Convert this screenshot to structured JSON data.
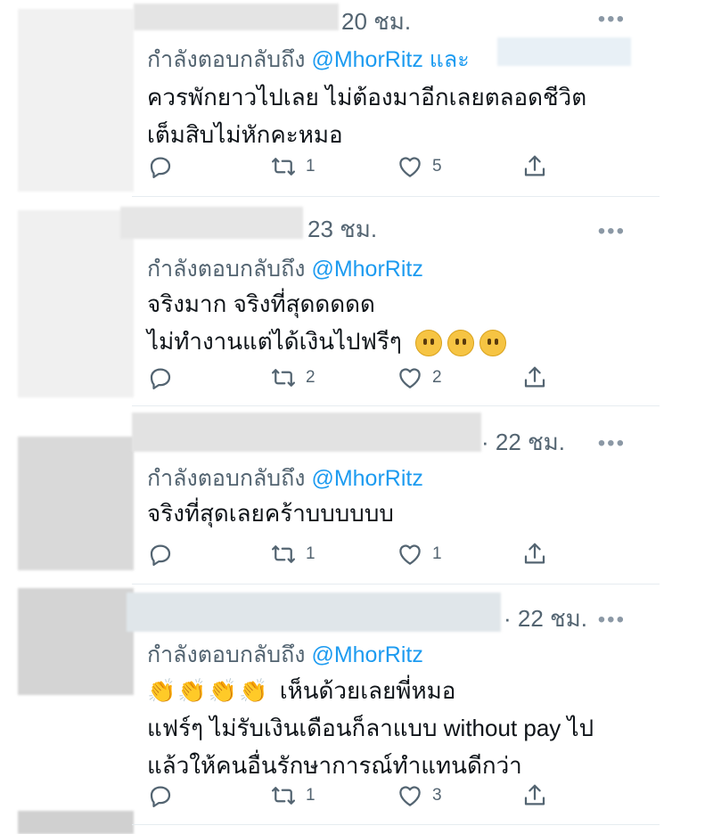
{
  "tweets": [
    {
      "time": "20 ชม.",
      "reply_prefix": "กำลังตอบกลับถึง",
      "reply_handle": "@MhorRitz",
      "reply_suffix": "และ",
      "lines": [
        "ควรพักยาวไปเลย ไม่ต้องมาอีกเลยตลอดชีวิต",
        "เต็มสิบไม่หักคะหมอ"
      ],
      "retweets": "1",
      "likes": "5"
    },
    {
      "time": "23 ชม.",
      "reply_prefix": "กำลังตอบกลับถึง",
      "reply_handle": "@MhorRitz",
      "lines": [
        "จริงมาก จริงที่สุดดดดด",
        "ไม่ทำงานแต่ได้เงินไปฟรีๆ"
      ],
      "retweets": "2",
      "likes": "2"
    },
    {
      "time": "· 22 ชม.",
      "reply_prefix": "กำลังตอบกลับถึง",
      "reply_handle": "@MhorRitz",
      "lines": [
        "จริงที่สุดเลยคร้าบบบบบบ"
      ],
      "retweets": "1",
      "likes": "1"
    },
    {
      "time": "· 22 ชม.",
      "reply_prefix": "กำลังตอบกลับถึง",
      "reply_handle": "@MhorRitz",
      "lines": [
        "เห็นด้วยเลยพี่หมอ",
        "แฟร์ๆ ไม่รับเงินเดือนก็ลาแบบ without pay ไป",
        "แล้วให้คนอื่นรักษาการณ์ทำแทนดีกว่า"
      ],
      "retweets": "1",
      "likes": "3"
    }
  ],
  "more_label": "•••",
  "icons": [
    "reply-icon",
    "retweet-icon",
    "like-icon",
    "share-icon",
    "grinning-face-icon",
    "clapping-hands-icon"
  ],
  "colors": {
    "handle": "#1d9bf0",
    "muted": "#536471",
    "text": "#0f1419"
  }
}
